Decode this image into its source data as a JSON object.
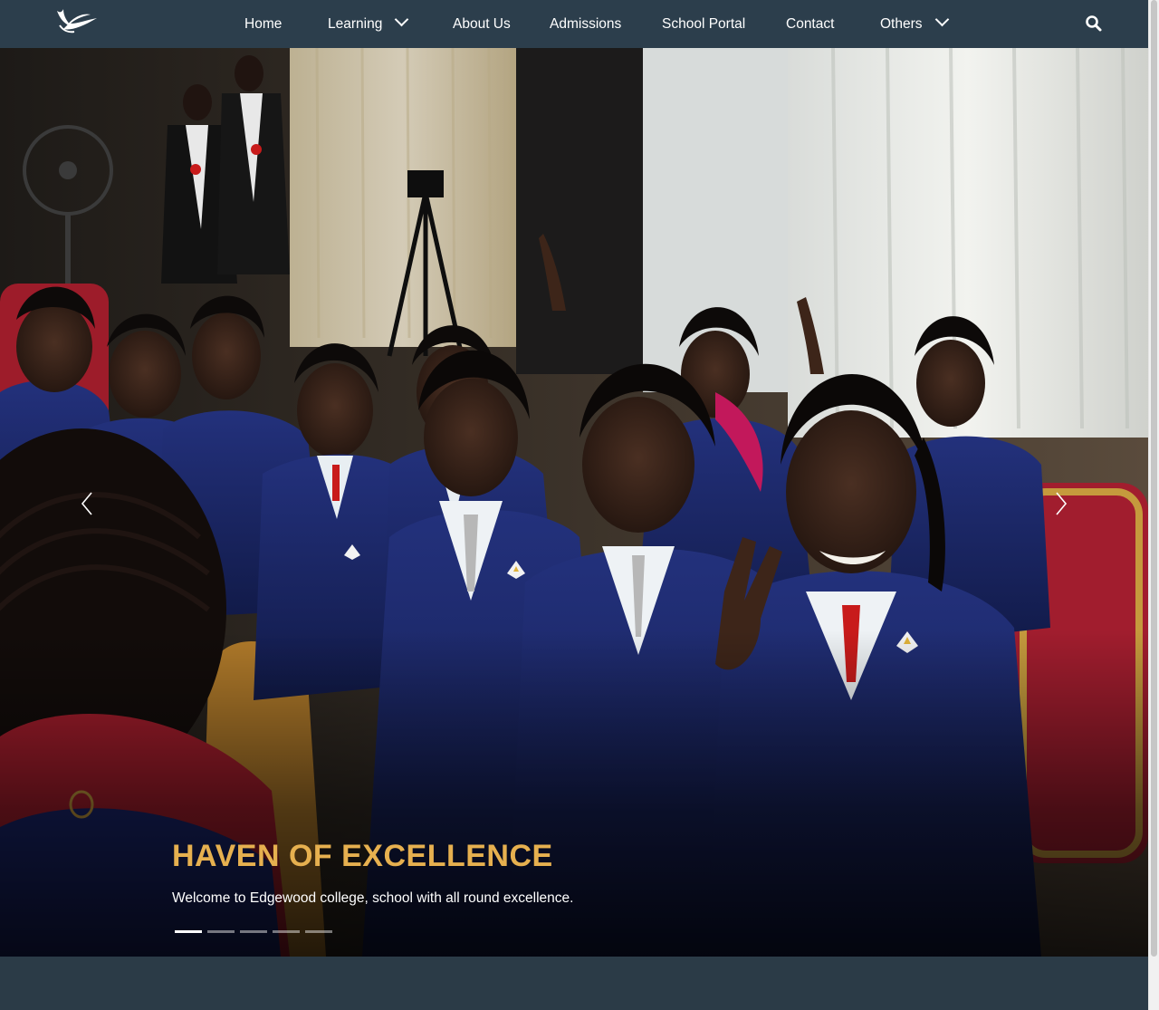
{
  "nav": {
    "logo_name": "bird-logo",
    "items": [
      {
        "label": "Home",
        "has_dropdown": false
      },
      {
        "label": "Learning",
        "has_dropdown": true
      },
      {
        "label": "About Us",
        "has_dropdown": false
      },
      {
        "label": "Admissions",
        "has_dropdown": false
      },
      {
        "label": "School Portal",
        "has_dropdown": false
      },
      {
        "label": "Contact",
        "has_dropdown": false
      },
      {
        "label": "Others",
        "has_dropdown": true
      }
    ],
    "search_icon": "search-icon"
  },
  "hero": {
    "title": "HAVEN OF EXCELLENCE",
    "text": "Welcome to Edgewood college, school with all round excellence.",
    "slide_count": 5,
    "active_slide": 1,
    "prev_icon": "chevron-left-icon",
    "next_icon": "chevron-right-icon"
  },
  "colors": {
    "navbar": "#2c3e4c",
    "title_gold": "#e6b04f",
    "gown_blue": "#1c2a6b",
    "text_white": "#ffffff"
  }
}
